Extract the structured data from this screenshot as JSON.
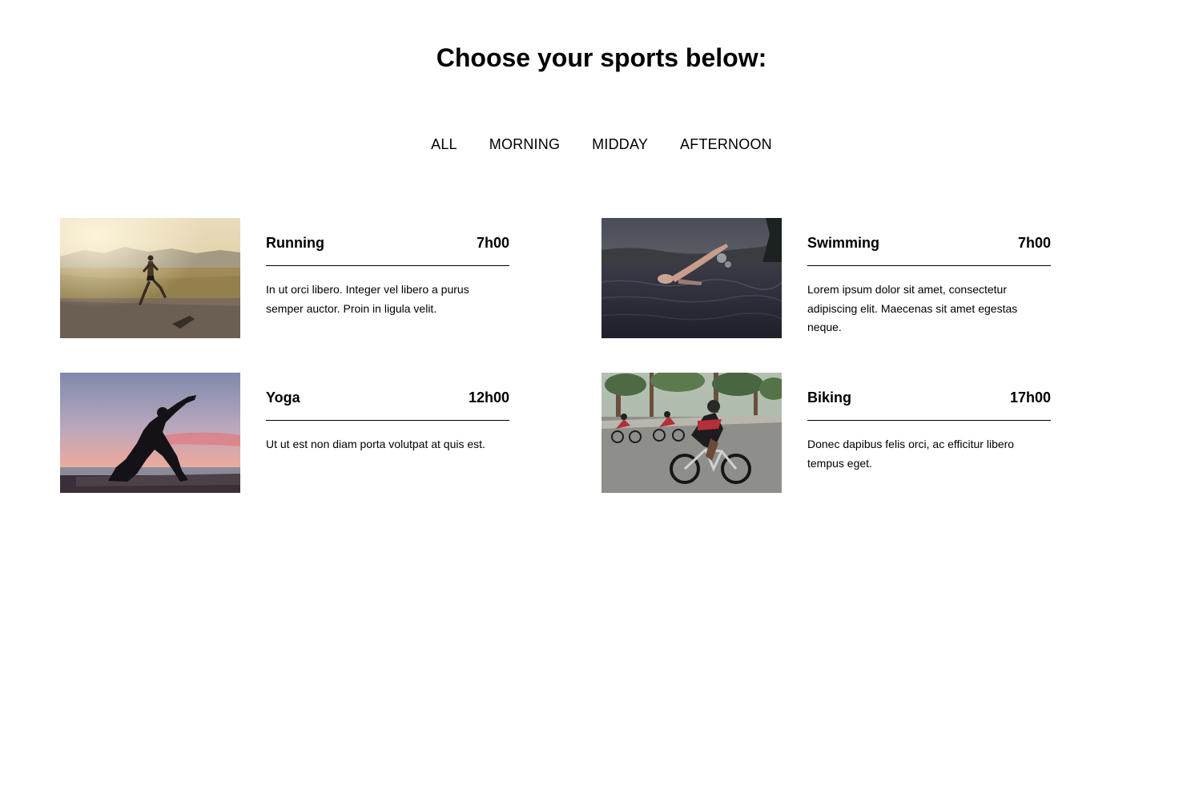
{
  "header": {
    "title": "Choose your sports below:"
  },
  "filters": [
    {
      "label": "ALL"
    },
    {
      "label": "MORNING"
    },
    {
      "label": "MIDDAY"
    },
    {
      "label": "AFTERNOON"
    }
  ],
  "activities": [
    {
      "name": "Running",
      "time": "7h00",
      "description": "In ut orci libero. Integer vel libero a purus semper auctor. Proin in ligula velit.",
      "image": "running-photo"
    },
    {
      "name": "Swimming",
      "time": "7h00",
      "description": "Lorem ipsum dolor sit amet, consectetur adipiscing elit. Maecenas sit amet egestas neque.",
      "image": "swimming-photo"
    },
    {
      "name": "Yoga",
      "time": "12h00",
      "description": "Ut ut est non diam porta volutpat at quis est.",
      "image": "yoga-photo"
    },
    {
      "name": "Biking",
      "time": "17h00",
      "description": "Donec dapibus felis orci, ac efficitur libero tempus eget.",
      "image": "biking-photo"
    }
  ]
}
